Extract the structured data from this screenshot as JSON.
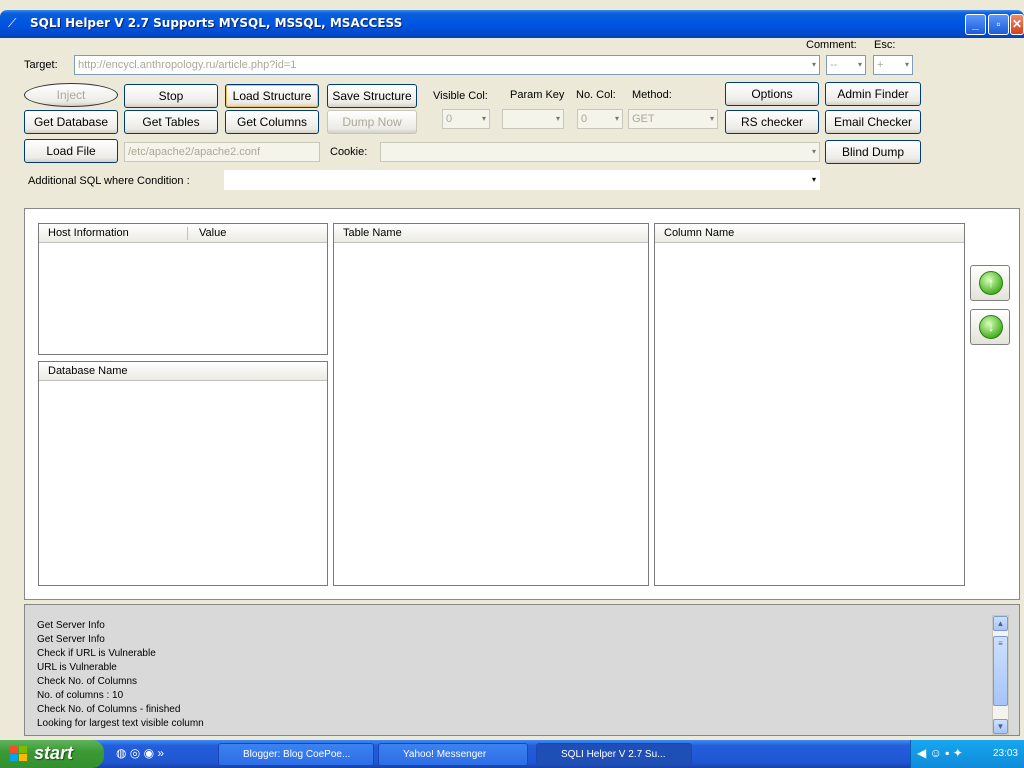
{
  "window": {
    "title": "SQLI Helper V 2.7 Supports MYSQL, MSSQL, MSACCESS",
    "min_icon": "minimize-icon",
    "max_icon": "maximize-icon",
    "close_icon": "close-icon"
  },
  "target": {
    "label": "Target:",
    "value": "http://encycl.anthropology.ru/article.php?id=1"
  },
  "comment": {
    "label": "Comment:",
    "esc_label": "Esc:",
    "comment_value": "--",
    "esc_value": "+"
  },
  "buttons": {
    "inject": "Inject",
    "stop": "Stop",
    "load_structure": "Load Structure",
    "save_structure": "Save Structure",
    "get_database": "Get Database",
    "get_tables": "Get Tables",
    "get_columns": "Get Columns",
    "dump_now": "Dump Now",
    "load_file": "Load File",
    "options": "Options",
    "rs_checker": "RS checker",
    "admin_finder": "Admin Finder",
    "email_checker": "Email Checker",
    "blind_dump": "Blind Dump"
  },
  "params": {
    "visible_col_label": "Visible Col:",
    "visible_col_value": "0",
    "param_key_label": "Param Key",
    "param_key_value": "",
    "no_col_label": "No. Col:",
    "no_col_value": "0",
    "method_label": "Method:",
    "method_value": "GET"
  },
  "load_file_path": "/etc/apache2/apache2.conf",
  "cookie_label": "Cookie:",
  "cookie_value": "",
  "sql_where": {
    "label": "Additional SQL where Condition :",
    "value": ""
  },
  "lists": {
    "host_info_col1": "Host Information",
    "host_info_col2": "Value",
    "database_name": "Database Name",
    "table_name": "Table Name",
    "column_name": "Column Name"
  },
  "log": [
    "Get Server Info",
    "Get Server Info",
    "Check if URL is Vulnerable",
    "URL is Vulnerable",
    "Check No. of Columns",
    "No. of columns : 10",
    "Check No. of Columns - finished",
    "Looking for largest text visible column"
  ],
  "taskbar": {
    "start": "start",
    "tasks": [
      {
        "label": "Blogger: Blog CoePoe...",
        "icon": "browser-icon"
      },
      {
        "label": "Yahoo! Messenger",
        "icon": "messenger-icon"
      },
      {
        "label": "SQLI Helper V 2.7 Su...",
        "icon": "app-icon"
      }
    ],
    "clock": "23:03"
  }
}
